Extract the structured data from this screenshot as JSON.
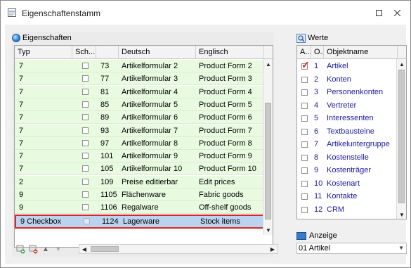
{
  "window": {
    "title": "Eigenschaftenstamm"
  },
  "left": {
    "heading": "Eigenschaften",
    "columns": [
      "Typ",
      "Sch...",
      "",
      "Deutsch",
      "Englisch"
    ],
    "rows": [
      {
        "typ": "7",
        "checked": false,
        "nr": "73",
        "deutsch": "Artikelformular 2",
        "englisch": "Product Form 2"
      },
      {
        "typ": "7",
        "checked": false,
        "nr": "77",
        "deutsch": "Artikelformular 3",
        "englisch": "Product Form 3"
      },
      {
        "typ": "7",
        "checked": false,
        "nr": "81",
        "deutsch": "Artikelformular 4",
        "englisch": "Product Form 4"
      },
      {
        "typ": "7",
        "checked": false,
        "nr": "85",
        "deutsch": "Artikelformular 5",
        "englisch": "Product Form 5"
      },
      {
        "typ": "7",
        "checked": false,
        "nr": "89",
        "deutsch": "Artikelformular 6",
        "englisch": "Product Form 6"
      },
      {
        "typ": "7",
        "checked": false,
        "nr": "93",
        "deutsch": "Artikelformular 7",
        "englisch": "Product Form 7"
      },
      {
        "typ": "7",
        "checked": false,
        "nr": "97",
        "deutsch": "Artikelformular 8",
        "englisch": "Product Form 8"
      },
      {
        "typ": "7",
        "checked": false,
        "nr": "101",
        "deutsch": "Artikelformular 9",
        "englisch": "Product Form 9"
      },
      {
        "typ": "7",
        "checked": false,
        "nr": "105",
        "deutsch": "Artikelformular 10",
        "englisch": "Product Form 10"
      },
      {
        "typ": "2",
        "checked": false,
        "nr": "109",
        "deutsch": "Preise editierbar",
        "englisch": "Edit prices"
      },
      {
        "typ": "9",
        "checked": false,
        "nr": "1105",
        "deutsch": "Flächenware",
        "englisch": "Fabric goods"
      },
      {
        "typ": "9",
        "checked": false,
        "nr": "1106",
        "deutsch": "Regalware",
        "englisch": "Off-shelf goods"
      }
    ],
    "selected_row": {
      "typ": "9  Checkbox",
      "checked": false,
      "nr": "1124",
      "deutsch": "Lagerware",
      "englisch": "Stock items"
    }
  },
  "right": {
    "heading": "Werte",
    "columns": [
      "A...",
      "O...",
      "Objektname"
    ],
    "rows": [
      {
        "checked": true,
        "nr": "1",
        "name": "Artikel"
      },
      {
        "checked": false,
        "nr": "2",
        "name": "Konten"
      },
      {
        "checked": false,
        "nr": "3",
        "name": "Personenkonten"
      },
      {
        "checked": false,
        "nr": "4",
        "name": "Vertreter"
      },
      {
        "checked": false,
        "nr": "5",
        "name": "Interessenten"
      },
      {
        "checked": false,
        "nr": "6",
        "name": "Textbausteine"
      },
      {
        "checked": false,
        "nr": "7",
        "name": "Artikeluntergruppe"
      },
      {
        "checked": false,
        "nr": "8",
        "name": "Kostenstelle"
      },
      {
        "checked": false,
        "nr": "9",
        "name": "Kostenträger"
      },
      {
        "checked": false,
        "nr": "10",
        "name": "Kostenart"
      },
      {
        "checked": false,
        "nr": "11",
        "name": "Kontakte"
      },
      {
        "checked": false,
        "nr": "12",
        "name": "CRM"
      }
    ],
    "anzeige_label": "Anzeige",
    "anzeige_value": "01 Artikel"
  }
}
